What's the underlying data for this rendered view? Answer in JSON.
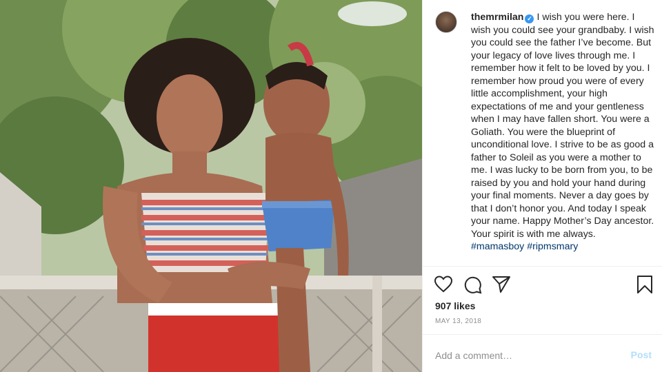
{
  "post": {
    "username": "themrmilan",
    "caption_text": "I wish you were here. I wish you could see your grandbaby. I wish you could see the father I’ve become. But your legacy of love lives through me. I remember how it felt to be loved by you. I remember how proud you were of every little accomplishment, your high expectations of me and your gentleness when I may have fallen short. You were a Goliath. You were the blueprint of unconditional love. I strive to be as good a father to Soleil as you were a mother to me. I was lucky to be born from you, to be raised by you and hold your hand during your final moments. Never a day goes by that I don’t honor you. And today I speak your name. Happy Mother’s Day ancestor. Your spirit is with me always.",
    "hashtags": [
      "#mamasboy",
      "#ripmsmary"
    ],
    "likes": "907 likes",
    "date": "MAY 13, 2018"
  },
  "comment": {
    "placeholder": "Add a comment…",
    "post_label": "Post"
  },
  "icons": {
    "like": "heart-icon",
    "comment": "comment-bubble-icon",
    "share": "paper-plane-icon",
    "save": "bookmark-icon",
    "verified": "verified-badge-icon"
  },
  "colors": {
    "link": "#00376b",
    "verified": "#3897f0",
    "post_disabled": "#b2dffc",
    "muted": "#8e8e8e"
  }
}
